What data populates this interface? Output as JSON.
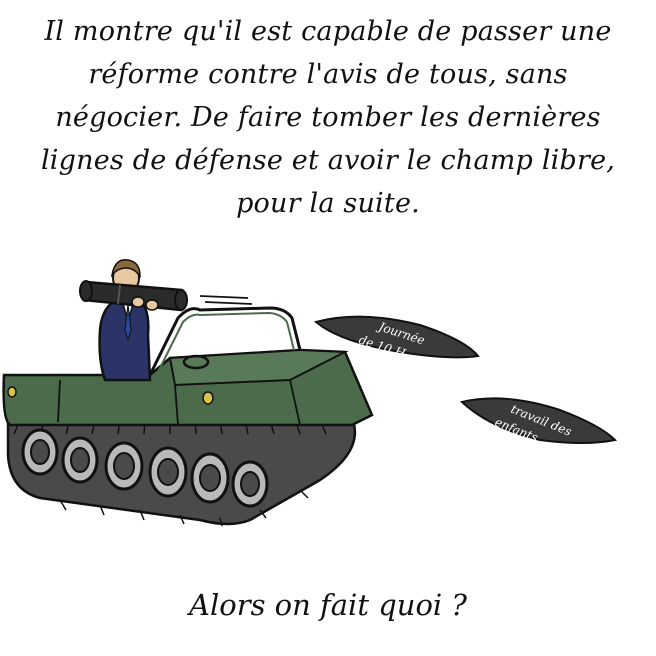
{
  "caption": {
    "lines": [
      "Il montre qu'il est capable de passer une",
      "réforme contre l'avis de tous, sans",
      "négocier. De faire tomber les dernières",
      "lignes de défense et avoir le champ libre,",
      "pour la suite."
    ]
  },
  "projectiles": {
    "first_label_line1": "Journée",
    "first_label_line2": "de 10 H",
    "second_label_line1": "travail des",
    "second_label_line2": "enfants"
  },
  "footer": {
    "question": "Alors on fait quoi ?"
  },
  "colors": {
    "tank_green": "#4b6b4b",
    "tank_dark": "#3a553a",
    "tread": "#4a4a4a",
    "wheel": "#b9b9b9",
    "suit": "#2a3466",
    "bazooka": "#2b2b2b",
    "skin": "#e8c8a0",
    "hair": "#8a6a3a"
  }
}
